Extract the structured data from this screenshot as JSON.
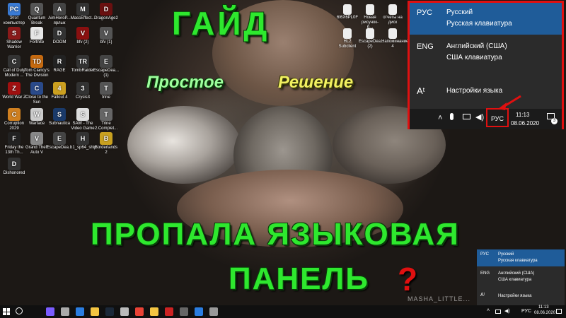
{
  "desktop_icons": [
    {
      "label": "Этот компьютер",
      "color": "#3a7bd5",
      "glyph": "PC"
    },
    {
      "label": "Quantum Break",
      "color": "#555",
      "glyph": "Q"
    },
    {
      "label": "AimHeroP... ярлык",
      "color": "#444",
      "glyph": "A"
    },
    {
      "label": "MassEffect...",
      "color": "#333",
      "glyph": "M"
    },
    {
      "label": "DragonAge2",
      "color": "#6a1010",
      "glyph": "D"
    },
    {
      "label": "Shadow Warrior",
      "color": "#8a1a1a",
      "glyph": "S"
    },
    {
      "label": "Fortnite",
      "color": "#e6e6e6",
      "glyph": "F"
    },
    {
      "label": "DOOM",
      "color": "#333",
      "glyph": "D"
    },
    {
      "label": "bfv (2)",
      "color": "#8a1010",
      "glyph": "V"
    },
    {
      "label": "bfv (1)",
      "color": "#555",
      "glyph": "V"
    },
    {
      "label": "Call of Duty Modern ...",
      "color": "#333",
      "glyph": "C"
    },
    {
      "label": "Tom Clancy's The Division",
      "color": "#c66a10",
      "glyph": "TD"
    },
    {
      "label": "RAGE",
      "color": "#222",
      "glyph": "R"
    },
    {
      "label": "TombRaider",
      "color": "#333",
      "glyph": "TR"
    },
    {
      "label": "EscapeDea... (1)",
      "color": "#444",
      "glyph": "E"
    },
    {
      "label": "World War Z",
      "color": "#a01010",
      "glyph": "Z"
    },
    {
      "label": "Close to the Sun",
      "color": "#2a4a8a",
      "glyph": "C"
    },
    {
      "label": "Fallout 4",
      "color": "#cca020",
      "glyph": "4"
    },
    {
      "label": "Crysis3",
      "color": "#333",
      "glyph": "3"
    },
    {
      "label": "trine",
      "color": "#555",
      "glyph": "T"
    },
    {
      "label": "Corruption 2029",
      "color": "#d08020",
      "glyph": "C"
    },
    {
      "label": "Warface",
      "color": "#ccc",
      "glyph": "W"
    },
    {
      "label": "Subnautica",
      "color": "#1a3a6a",
      "glyph": "S"
    },
    {
      "label": "SAW - The Video Game",
      "color": "#ddd",
      "glyph": "S"
    },
    {
      "label": "Trine 2.Complet...",
      "color": "#666",
      "glyph": "T"
    },
    {
      "label": "Friday the 13th Th...",
      "color": "#222",
      "glyph": "F"
    },
    {
      "label": "Grand Theft Auto V",
      "color": "#888",
      "glyph": "V"
    },
    {
      "label": "EscapeDea...",
      "color": "#444",
      "glyph": "E"
    },
    {
      "label": "h1_sp64_ship",
      "color": "#333",
      "glyph": "H"
    },
    {
      "label": "Borderlands 2",
      "color": "#c8a020",
      "glyph": "B"
    },
    {
      "label": "Dishonored",
      "color": "#333",
      "glyph": "D"
    }
  ],
  "top_files": [
    {
      "label": "6t6X6PL0F"
    },
    {
      "label": "Новая рисунок-б..."
    },
    {
      "label": "отчеты на диск"
    },
    {
      "label": "HL2 Subclient"
    },
    {
      "label": "EscapeDea... (2)"
    },
    {
      "label": "Напоминание 4"
    }
  ],
  "title": {
    "main": "ГАЙД",
    "left": "Простое",
    "right": "Решение",
    "big_line1": "ПРОПАЛА ЯЗЫКОВАЯ",
    "big_line2": "ПАНЕЛЬ",
    "question": "?"
  },
  "watermark": "MASHA_LITTLE...",
  "lang_popup_large": {
    "items": [
      {
        "code": "РУС",
        "line1": "Русский",
        "line2": "Русская клавиатура"
      },
      {
        "code": "ENG",
        "line1": "Английский (США)",
        "line2": "США клавиатура"
      },
      {
        "code": "Aᵗ",
        "line1": "Настройки языка",
        "line2": ""
      }
    ],
    "tray_lang": "РУС",
    "time": "11:13",
    "date": "08.06.2020",
    "notif_count": "3",
    "highlight_color": "#e01010"
  },
  "lang_popup_small": {
    "items": [
      {
        "code": "РУС",
        "line1": "Русский",
        "line2": "Русская клавиатура"
      },
      {
        "code": "ENG",
        "line1": "Английский (США)",
        "line2": "США клавиатура"
      },
      {
        "code": "Aᵗ",
        "line1": "Настройки языка",
        "line2": ""
      }
    ]
  },
  "taskbar": {
    "lang": "РУС",
    "time": "11:13",
    "date": "08.06.2020",
    "apps": [
      {
        "name": "cortana",
        "color": "#7a5cff"
      },
      {
        "name": "task-view",
        "color": "#aaa"
      },
      {
        "name": "store",
        "color": "#2a7de1"
      },
      {
        "name": "explorer",
        "color": "#f4c542"
      },
      {
        "name": "steam",
        "color": "#1b2838"
      },
      {
        "name": "clock",
        "color": "#bbb"
      },
      {
        "name": "chrome",
        "color": "#e94235"
      },
      {
        "name": "files",
        "color": "#f4c542"
      },
      {
        "name": "video",
        "color": "#c22"
      },
      {
        "name": "media",
        "color": "#666"
      },
      {
        "name": "vpn",
        "color": "#2a7de1"
      },
      {
        "name": "app",
        "color": "#999"
      }
    ]
  }
}
